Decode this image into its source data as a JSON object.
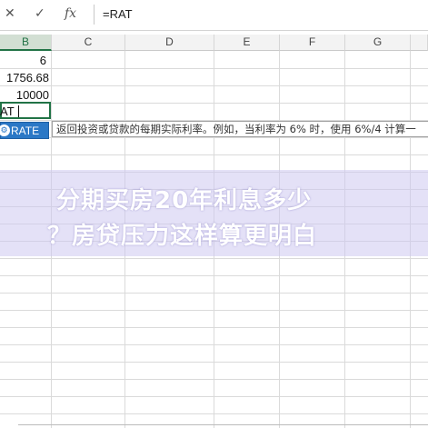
{
  "formula_bar": {
    "cancel_icon": "close-icon",
    "confirm_icon": "check-icon",
    "function_icon": "fx-icon",
    "cancel_symbol": "✕",
    "confirm_symbol": "✓",
    "function_symbol": "fx",
    "formula": "=RAT"
  },
  "columns": [
    "B",
    "C",
    "D",
    "E",
    "F",
    "G"
  ],
  "selected_column": "B",
  "cells": {
    "b_row1": "6",
    "b_row2": "1756.68",
    "b_row3": "10000"
  },
  "active_cell": {
    "text": "AT"
  },
  "autocomplete": {
    "function_name": "RATE",
    "icon_symbol": "⚙"
  },
  "tooltip": {
    "text": "返回投资或贷款的每期实际利率。例如，当利率为 6% 时，使用 6%/4 计算一"
  },
  "banner": {
    "line1": "分期买房20年利息多少",
    "line2": "？房贷压力这样算更明白"
  },
  "colors": {
    "accent": "#217346",
    "autocomplete_bg": "#2b78c6",
    "banner_bg": "#cdc8f0"
  }
}
